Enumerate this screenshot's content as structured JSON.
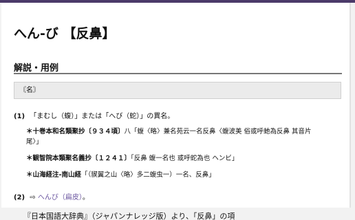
{
  "entry": {
    "title": "へん‐び 【反鼻】",
    "section_heading": "解説・用例",
    "part_of_speech": "〘名〙",
    "senses": [
      {
        "num": "(1)",
        "text": "「まむし（蝮）」または「へび（蛇）」の異名。",
        "examples": [
          {
            "src": "＊十巻本和名類聚抄〔９３４頃〕",
            "text": "八「蝮〈略〉兼名苑云一名反鼻〈蝮波美 俗或呼虵為反鼻 其音片尾〉」"
          },
          {
            "src": "＊観智院本類聚名義抄〔１２４１〕",
            "text": "「反鼻 蝮一名也 或呼蛇為也 ヘンビ」"
          },
          {
            "src": "＊山海経注‐南山経",
            "text": "「（䝟翼之山〈略〉多二蝮虫一）一名、反鼻」"
          }
        ]
      },
      {
        "num": "(2)",
        "arrow": "⇨",
        "link_text": "へんび（扁皮）",
        "after": "。"
      }
    ]
  },
  "caption": "『日本国語大辞典』（ジャパンナレッジ版）より、「反鼻」の項",
  "colors": {
    "top_bar": "#4b3a69",
    "link": "#6b56a0"
  }
}
